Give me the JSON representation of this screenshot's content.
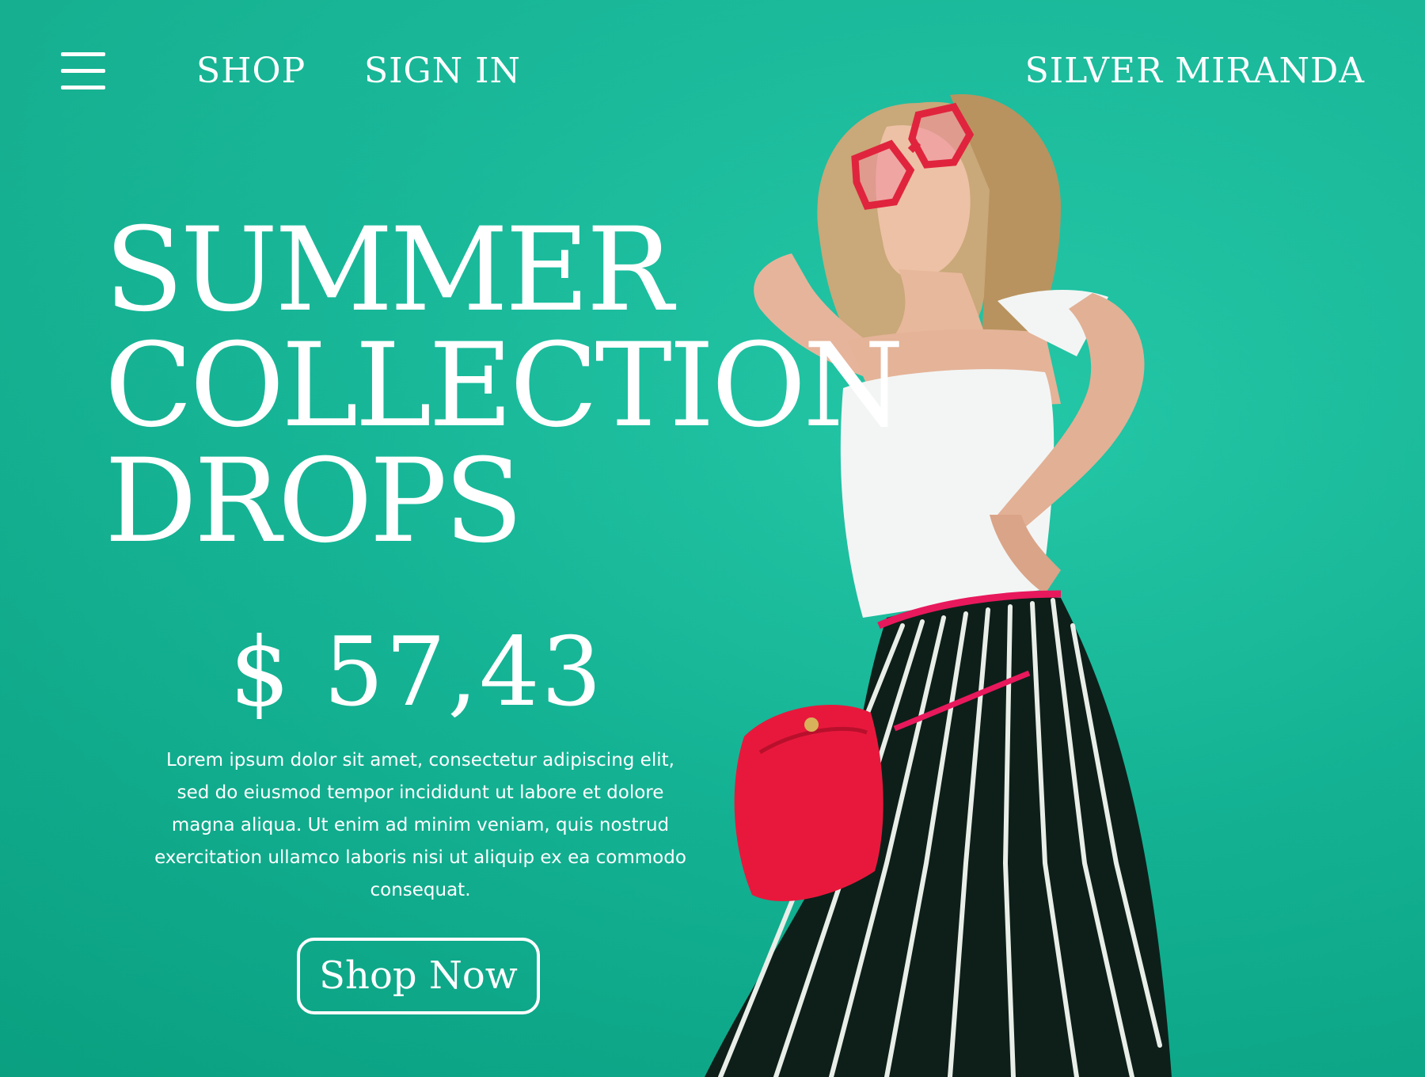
{
  "nav": {
    "menu_icon": "hamburger-menu-icon",
    "links": [
      {
        "label": "SHOP"
      },
      {
        "label": "SIGN IN"
      }
    ],
    "brand": "SILVER MIRANDA"
  },
  "hero": {
    "headline_lines": [
      "SUMMER",
      "COLLECTION",
      "DROPS"
    ],
    "price": "$ 57,43",
    "description": "Lorem ipsum dolor sit amet, consectetur adipiscing elit, sed do eiusmod tempor incididunt ut labore et dolore magna aliqua. Ut enim ad minim veniam, quis nostrud exercitation ullamco laboris nisi ut aliquip ex ea commodo consequat.",
    "cta_label": "Shop Now"
  },
  "colors": {
    "background": "#13ba9a",
    "text": "#ffffff",
    "accent_bag": "#e8183c",
    "top": "#f4f4f4",
    "pants": "#0e1f1a"
  }
}
